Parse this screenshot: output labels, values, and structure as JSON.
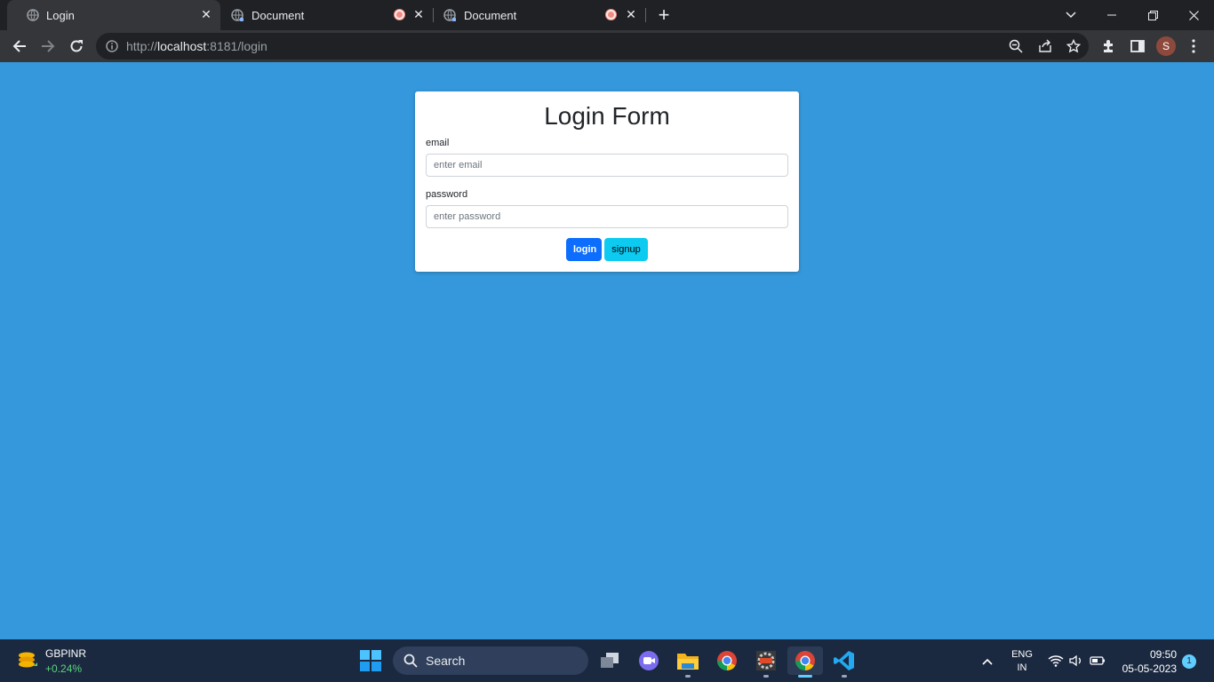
{
  "browser": {
    "tabs": [
      {
        "title": "Login",
        "active": true
      },
      {
        "title": "Document",
        "active": false,
        "recording": true
      },
      {
        "title": "Document",
        "active": false,
        "recording": true
      }
    ],
    "url_scheme": "http://",
    "url_host": "localhost",
    "url_rest": ":8181/login",
    "profile_initial": "S",
    "colors": {
      "tabstrip": "#202124",
      "toolbar": "#35363a",
      "omnibox": "#202124"
    }
  },
  "page": {
    "background": "#3598dc",
    "form": {
      "title": "Login Form",
      "email_label": "email",
      "email_placeholder": "enter email",
      "email_value": "",
      "password_label": "password",
      "password_placeholder": "enter password",
      "password_value": "",
      "login_label": "login",
      "signup_label": "signup"
    },
    "colors": {
      "login_button": "#0d6efd",
      "signup_button": "#0dcaf0"
    }
  },
  "taskbar": {
    "widget": {
      "symbol": "GBPINR",
      "change": "+0.24%"
    },
    "search_label": "Search",
    "apps": [
      "task-view-icon",
      "meet-icon",
      "file-explorer-icon",
      "chrome-icon",
      "ide-icon",
      "chrome-icon",
      "vscode-icon"
    ],
    "language": {
      "line1": "ENG",
      "line2": "IN"
    },
    "time": "09:50",
    "date": "05-05-2023",
    "notification_count": "1"
  }
}
